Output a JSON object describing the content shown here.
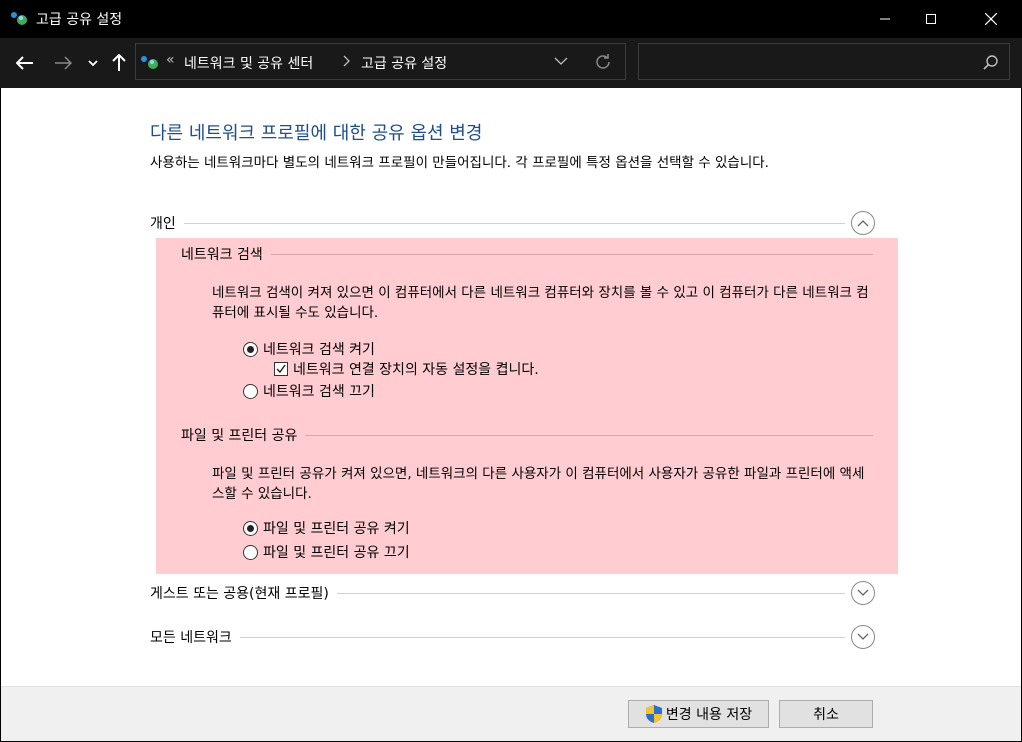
{
  "window": {
    "title": "고급 공유 설정"
  },
  "address": {
    "overflow": "«",
    "crumb1": "네트워크 및 공유 센터",
    "crumb2": "고급 공유 설정"
  },
  "search": {
    "placeholder": ""
  },
  "page": {
    "title": "다른 네트워크 프로필에 대한 공유 옵션 변경",
    "description": "사용하는 네트워크마다 별도의 네트워크 프로필이 만들어집니다. 각 프로필에 특정 옵션을 선택할 수 있습니다."
  },
  "sections": {
    "private": {
      "label": "개인",
      "network_discovery": {
        "header": "네트워크 검색",
        "description": "네트워크 검색이 켜져 있으면 이 컴퓨터에서 다른 네트워크 컴퓨터와 장치를 볼 수 있고 이 컴퓨터가 다른 네트워크 컴퓨터에 표시될 수도 있습니다.",
        "on_label": "네트워크 검색 켜기",
        "auto_setup_label": "네트워크 연결 장치의 자동 설정을 켭니다.",
        "off_label": "네트워크 검색 끄기",
        "selected": "on",
        "auto_setup_checked": true
      },
      "file_printer": {
        "header": "파일 및 프린터 공유",
        "description": "파일 및 프린터 공유가 켜져 있으면, 네트워크의 다른 사용자가 이 컴퓨터에서 사용자가 공유한 파일과 프린터에 액세스할 수 있습니다.",
        "on_label": "파일 및 프린터 공유 켜기",
        "off_label": "파일 및 프린터 공유 끄기",
        "selected": "on"
      }
    },
    "guest": {
      "label": "게스트 또는 공용(현재 프로필)"
    },
    "all": {
      "label": "모든 네트워크"
    }
  },
  "footer": {
    "save_label": "변경 내용 저장",
    "cancel_label": "취소"
  },
  "colors": {
    "title_blue": "#1e4e8c",
    "panel_pink": "#ffccd1"
  }
}
